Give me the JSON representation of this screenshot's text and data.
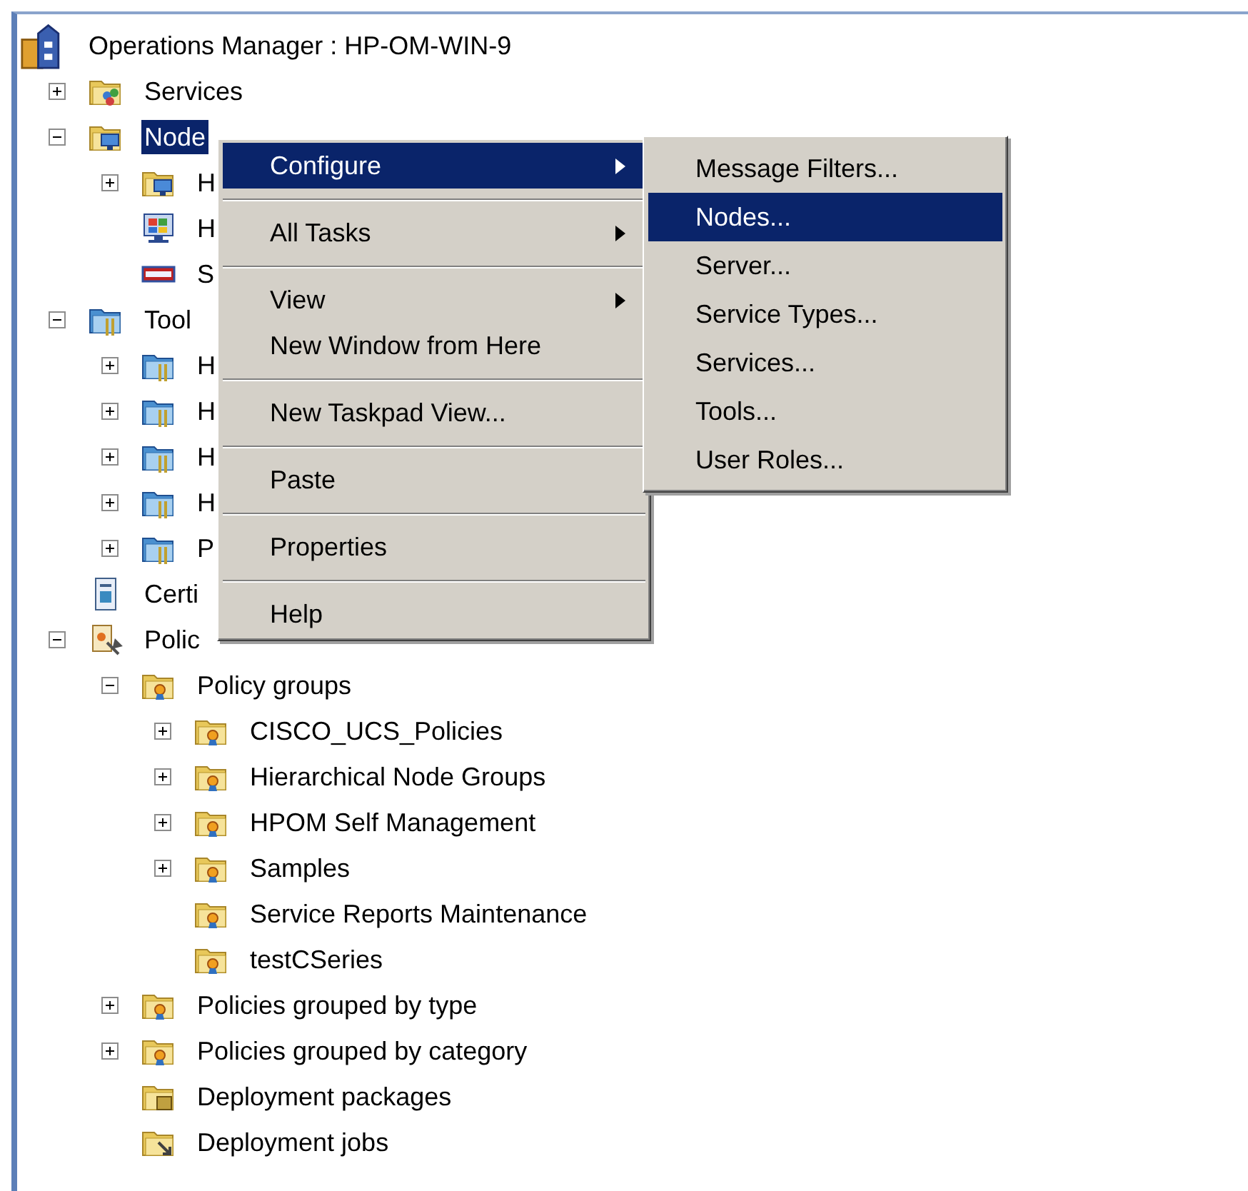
{
  "tree": [
    {
      "label": "Operations Manager : HP-OM-WIN-9",
      "kind": "console",
      "selected": false,
      "children": [
        {
          "label": "Services",
          "kind": "services",
          "expanded": false,
          "selected": false
        },
        {
          "label": "Node",
          "kind": "node-group",
          "expanded": true,
          "selected": true,
          "children": [
            {
              "label": "H",
              "kind": "node-group",
              "expanded": false,
              "selected": false
            },
            {
              "label": "H",
              "kind": "node",
              "selected": false
            },
            {
              "label": "S",
              "kind": "snmp-node",
              "selected": false
            }
          ]
        },
        {
          "label": "Tool",
          "kind": "tool-group",
          "expanded": true,
          "selected": false,
          "children": [
            {
              "label": "H",
              "kind": "tool-group",
              "expanded": false,
              "selected": false
            },
            {
              "label": "H",
              "kind": "tool-group",
              "expanded": false,
              "selected": false
            },
            {
              "label": "H",
              "kind": "tool-group",
              "expanded": false,
              "selected": false
            },
            {
              "label": "H",
              "kind": "tool-group",
              "expanded": false,
              "selected": false
            },
            {
              "label": "P",
              "kind": "tool-group",
              "expanded": false,
              "selected": false
            }
          ]
        },
        {
          "label": "Certi",
          "kind": "certificates",
          "selected": false
        },
        {
          "label": "Polic",
          "kind": "policies",
          "expanded": true,
          "selected": false,
          "children": [
            {
              "label": "Policy groups",
              "kind": "policy-group",
              "expanded": true,
              "selected": false,
              "children": [
                {
                  "label": "CISCO_UCS_Policies",
                  "kind": "policy-group",
                  "expanded": false,
                  "selected": false
                },
                {
                  "label": "Hierarchical Node Groups",
                  "kind": "policy-group",
                  "expanded": false,
                  "selected": false
                },
                {
                  "label": "HPOM Self Management",
                  "kind": "policy-group",
                  "expanded": false,
                  "selected": false
                },
                {
                  "label": "Samples",
                  "kind": "policy-group",
                  "expanded": false,
                  "selected": false
                },
                {
                  "label": "Service Reports Maintenance",
                  "kind": "policy-group",
                  "selected": false
                },
                {
                  "label": "testCSeries",
                  "kind": "policy-group",
                  "selected": false
                }
              ]
            },
            {
              "label": "Policies grouped by type",
              "kind": "policy-group",
              "expanded": false,
              "selected": false
            },
            {
              "label": "Policies grouped by category",
              "kind": "policy-group",
              "expanded": false,
              "selected": false
            },
            {
              "label": "Deployment packages",
              "kind": "packages",
              "selected": false
            },
            {
              "label": "Deployment jobs",
              "kind": "jobs",
              "selected": false
            }
          ]
        }
      ]
    }
  ],
  "context_menu": {
    "groups": [
      [
        {
          "label": "Configure",
          "submenu": true,
          "selected": true
        }
      ],
      [
        {
          "label": "All Tasks",
          "submenu": true,
          "selected": false
        }
      ],
      [
        {
          "label": "View",
          "submenu": true,
          "selected": false
        },
        {
          "label": "New Window from Here",
          "submenu": false,
          "selected": false
        }
      ],
      [
        {
          "label": "New Taskpad View...",
          "submenu": false,
          "selected": false
        }
      ],
      [
        {
          "label": "Paste",
          "submenu": false,
          "selected": false
        }
      ],
      [
        {
          "label": "Properties",
          "submenu": false,
          "selected": false
        }
      ],
      [
        {
          "label": "Help",
          "submenu": false,
          "selected": false
        }
      ]
    ]
  },
  "submenu": {
    "items": [
      {
        "label": "Message Filters...",
        "selected": false
      },
      {
        "label": "Nodes...",
        "selected": true
      },
      {
        "label": "Server...",
        "selected": false
      },
      {
        "label": "Service Types...",
        "selected": false
      },
      {
        "label": "Services...",
        "selected": false
      },
      {
        "label": "Tools...",
        "selected": false
      },
      {
        "label": "User Roles...",
        "selected": false
      }
    ]
  }
}
